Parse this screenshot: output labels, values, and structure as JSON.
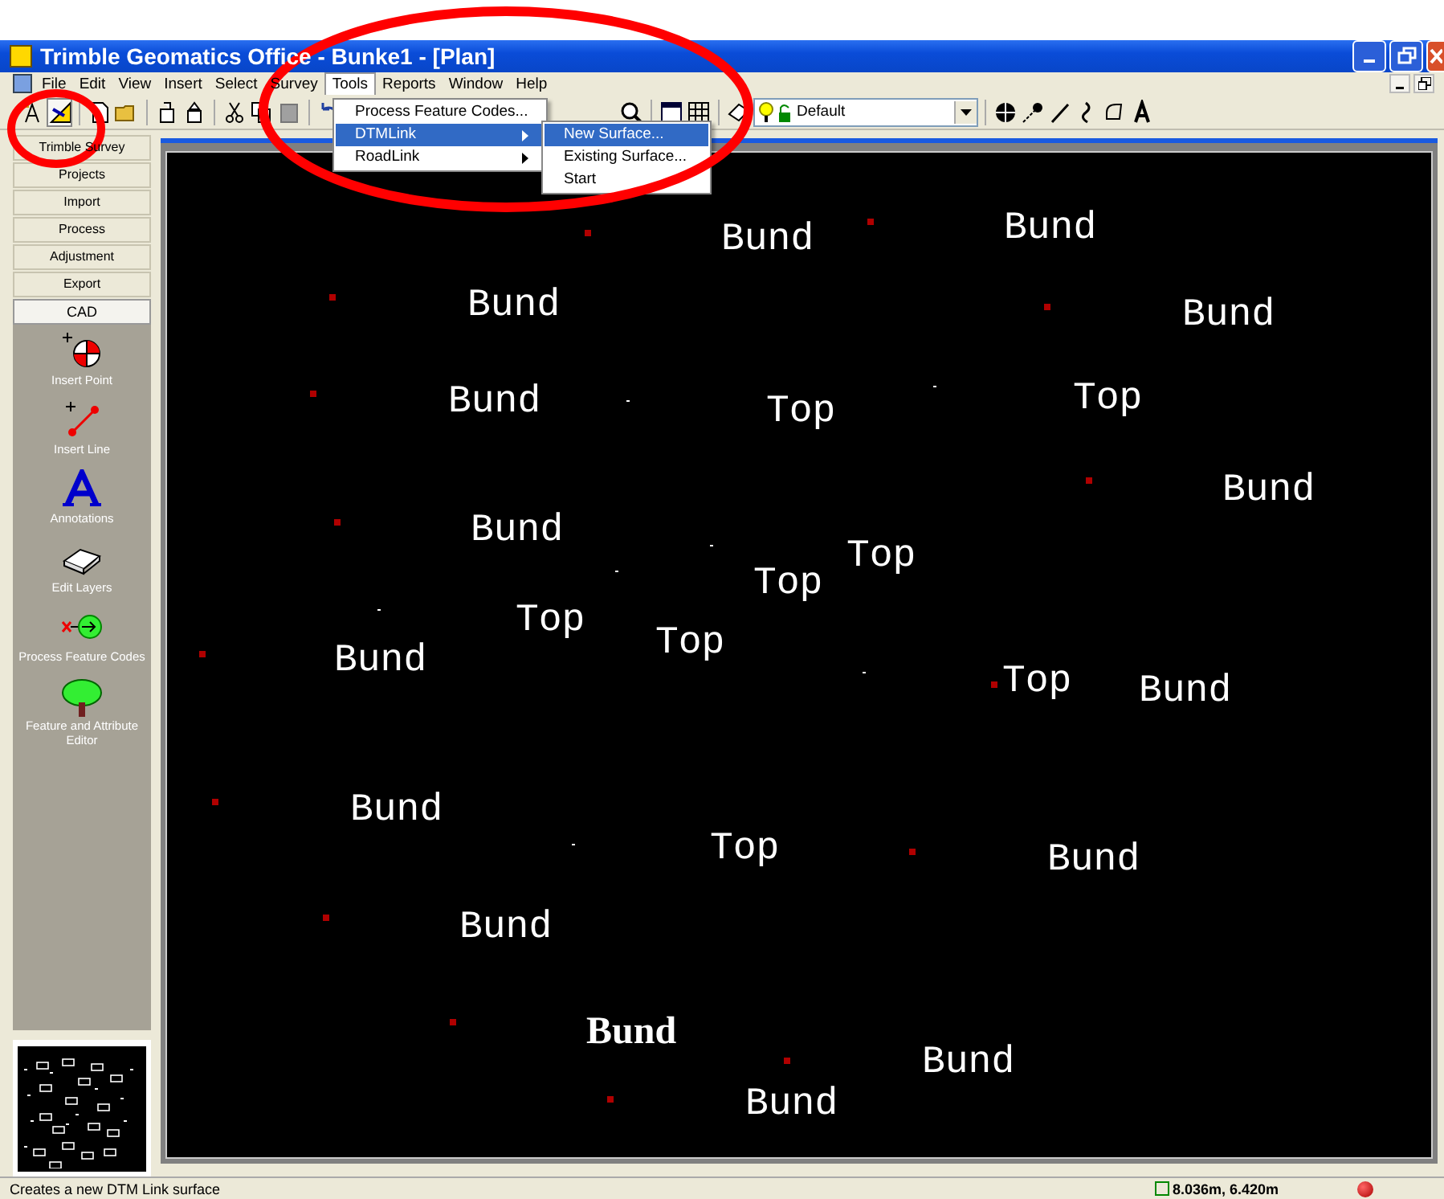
{
  "window": {
    "title": "Trimble Geomatics Office - Bunke1 - [Plan]"
  },
  "menu": [
    {
      "label": "File",
      "selected": false
    },
    {
      "label": "Edit",
      "selected": false
    },
    {
      "label": "View",
      "selected": false
    },
    {
      "label": "Insert",
      "selected": false
    },
    {
      "label": "Select",
      "selected": false
    },
    {
      "label": "Survey",
      "selected": false
    },
    {
      "label": "Tools",
      "selected": true
    },
    {
      "label": "Reports",
      "selected": false
    },
    {
      "label": "Window",
      "selected": false
    },
    {
      "label": "Help",
      "selected": false
    }
  ],
  "tools_menu": [
    {
      "label": "Process Feature Codes...",
      "submenu": false,
      "selected": false
    },
    {
      "label": "DTMLink",
      "submenu": true,
      "selected": true
    },
    {
      "label": "RoadLink",
      "submenu": true,
      "selected": false
    }
  ],
  "dtmlink_submenu": [
    {
      "label": "New Surface...",
      "selected": true
    },
    {
      "label": "Existing Surface...",
      "selected": false
    },
    {
      "label": "Start",
      "selected": false
    }
  ],
  "layer_combo": {
    "value": "Default"
  },
  "sidebar": {
    "groups": [
      {
        "label": "Trimble Survey",
        "selected": false
      },
      {
        "label": "Projects",
        "selected": false
      },
      {
        "label": "Import",
        "selected": false
      },
      {
        "label": "Process",
        "selected": false
      },
      {
        "label": "Adjustment",
        "selected": false
      },
      {
        "label": "Export",
        "selected": false
      },
      {
        "label": "CAD",
        "selected": true
      }
    ],
    "tools": [
      {
        "label": "Insert Point",
        "kind": "point"
      },
      {
        "label": "Insert Line",
        "kind": "line"
      },
      {
        "label": "Annotations",
        "kind": "annotation"
      },
      {
        "label": "Edit Layers",
        "kind": "layers"
      },
      {
        "label": "Process Feature Codes",
        "kind": "codes"
      },
      {
        "label": "Feature and Attribute Editor",
        "kind": "tree"
      }
    ]
  },
  "plan_labels": [
    {
      "text": "Bund",
      "bold": false
    },
    {
      "text": "Bund",
      "bold": false
    },
    {
      "text": "Bund",
      "bold": false
    },
    {
      "text": "Bund",
      "bold": false
    },
    {
      "text": "Bund",
      "bold": false
    },
    {
      "text": "Top",
      "bold": false
    },
    {
      "text": "Top",
      "bold": false
    },
    {
      "text": "Bund",
      "bold": false
    },
    {
      "text": "Bund",
      "bold": false
    },
    {
      "text": "Top",
      "bold": false
    },
    {
      "text": "Top",
      "bold": false
    },
    {
      "text": "Top",
      "bold": false
    },
    {
      "text": "Bund",
      "bold": false
    },
    {
      "text": "Top",
      "bold": false
    },
    {
      "text": "Top",
      "bold": false
    },
    {
      "text": "Bund",
      "bold": false
    },
    {
      "text": "Bund",
      "bold": false
    },
    {
      "text": "Top",
      "bold": false
    },
    {
      "text": "Bund",
      "bold": false
    },
    {
      "text": "Bund",
      "bold": false
    },
    {
      "text": "Bund",
      "bold": true
    },
    {
      "text": "Bund",
      "bold": false
    },
    {
      "text": "Bund",
      "bold": false
    }
  ],
  "status_bar": {
    "message": "Creates a new DTM Link surface",
    "coordinates": "8.036m, 6.420m"
  }
}
